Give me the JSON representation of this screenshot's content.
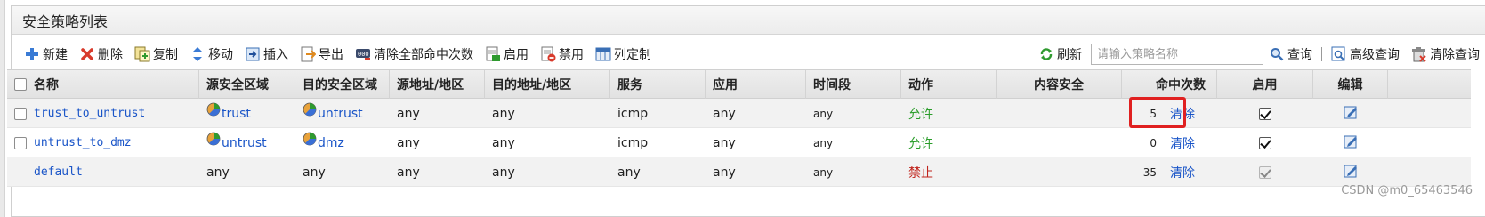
{
  "panel": {
    "title": "安全策略列表"
  },
  "toolbar": {
    "new": "新建",
    "delete": "删除",
    "copy": "复制",
    "move": "移动",
    "insert": "插入",
    "export": "导出",
    "clear_all_hits": "清除全部命中次数",
    "enable": "启用",
    "disable": "禁用",
    "customize_columns": "列定制",
    "refresh": "刷新",
    "search_placeholder": "请输入策略名称",
    "search": "查询",
    "advanced_search": "高级查询",
    "clear_search": "清除查询"
  },
  "columns": [
    "名称",
    "源安全区域",
    "目的安全区域",
    "源地址/地区",
    "目的地址/地区",
    "服务",
    "应用",
    "时间段",
    "动作",
    "内容安全",
    "命中次数",
    "启用",
    "编辑"
  ],
  "rows": [
    {
      "name": "trust_to_untrust",
      "src_zone": "trust",
      "dst_zone": "untrust",
      "src_addr": "any",
      "dst_addr": "any",
      "service": "icmp",
      "app": "any",
      "schedule": "any",
      "action": "允许",
      "content_security": "",
      "hits": "5",
      "clear": "清除",
      "enabled": true
    },
    {
      "name": "untrust_to_dmz",
      "src_zone": "untrust",
      "dst_zone": "dmz",
      "src_addr": "any",
      "dst_addr": "any",
      "service": "icmp",
      "app": "any",
      "schedule": "any",
      "action": "允许",
      "content_security": "",
      "hits": "0",
      "clear": "清除",
      "enabled": true
    },
    {
      "name": "default",
      "src_zone": "any",
      "dst_zone": "any",
      "src_addr": "any",
      "dst_addr": "any",
      "service": "any",
      "app": "any",
      "schedule": "any",
      "action": "禁止",
      "content_security": "",
      "hits": "35",
      "clear": "清除",
      "enabled": true
    }
  ],
  "watermark": "CSDN @m0_65463546",
  "colors": {
    "allow": "#2a9d2a",
    "deny": "#c0241c",
    "link": "#1a55c8",
    "highlight": "#e02020"
  },
  "icons": [
    "plus-icon",
    "delete-x-icon",
    "copy-icon",
    "move-icon",
    "insert-icon",
    "export-icon",
    "clear-hits-icon",
    "enable-icon",
    "disable-icon",
    "columns-icon",
    "refresh-icon",
    "search-icon",
    "advanced-search-icon",
    "clear-search-icon",
    "zone-icon",
    "edit-icon"
  ]
}
